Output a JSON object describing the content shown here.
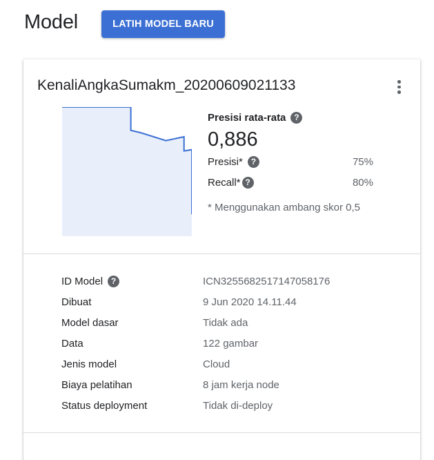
{
  "header": {
    "title": "Model",
    "train_button": "LATIH MODEL BARU"
  },
  "card": {
    "model_name": "KenaliAngkaSumakm_20200609021133",
    "more_icon": "more-vert-icon",
    "metrics": {
      "avg_precision_label": "Presisi rata-rata",
      "avg_precision_value": "0,886",
      "precision_label": "Presisi*",
      "precision_value": "75%",
      "recall_label": "Recall*",
      "recall_value": "80%",
      "footnote": "* Menggunakan ambang skor 0,5"
    },
    "details": [
      {
        "label": "ID Model",
        "value": "ICN3255682517147058176",
        "help": true
      },
      {
        "label": "Dibuat",
        "value": "9 Jun 2020 14.11.44",
        "help": false
      },
      {
        "label": "Model dasar",
        "value": "Tidak ada",
        "help": false
      },
      {
        "label": "Data",
        "value": "122 gambar",
        "help": false
      },
      {
        "label": "Jenis model",
        "value": "Cloud",
        "help": false
      },
      {
        "label": "Biaya pelatihan",
        "value": "8 jam kerja node",
        "help": false
      },
      {
        "label": "Status deployment",
        "value": "Tidak di-deploy",
        "help": false
      }
    ]
  },
  "chart_data": {
    "type": "area",
    "x": [
      0.0,
      0.53,
      0.53,
      0.61,
      0.8,
      0.94,
      0.94,
      1.0,
      1.0
    ],
    "y": [
      1.0,
      1.0,
      0.82,
      0.8,
      0.74,
      0.77,
      0.66,
      0.67,
      0.17
    ],
    "xlim": [
      0,
      1
    ],
    "ylim": [
      0,
      1
    ],
    "colors": {
      "line": "#3b6fd4",
      "fill": "#e8eefa"
    }
  }
}
